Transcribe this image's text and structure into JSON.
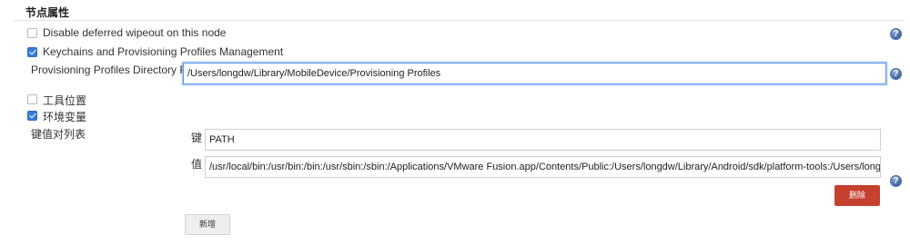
{
  "section": {
    "title": "节点属性"
  },
  "options": {
    "deferred_wipeout": {
      "label": "Disable deferred wipeout on this node",
      "checked": false
    },
    "keychains": {
      "label": "Keychains and Provisioning Profiles Management",
      "checked": true
    },
    "tool_location": {
      "label": "工具位置",
      "checked": false
    },
    "env_vars": {
      "label": "环境变量",
      "checked": true
    }
  },
  "provisioning": {
    "label": "Provisioning Profiles Directory Path",
    "value": "/Users/longdw/Library/MobileDevice/Provisioning Profiles"
  },
  "env": {
    "list_label": "键值对列表",
    "key_label": "键",
    "value_label": "值",
    "key_value": "PATH",
    "value_value": "/usr/local/bin:/usr/bin:/bin:/usr/sbin:/sbin:/Applications/VMware Fusion.app/Contents/Public:/Users/longdw/Library/Android/sdk/platform-tools:/Users/longdw/Lib",
    "delete_label": "删除",
    "add_label": "新增"
  },
  "help": {
    "glyph": "?"
  },
  "colors": {
    "accent": "#3a7bd5",
    "danger": "#c5402f",
    "focus": "#5b9ae8"
  }
}
